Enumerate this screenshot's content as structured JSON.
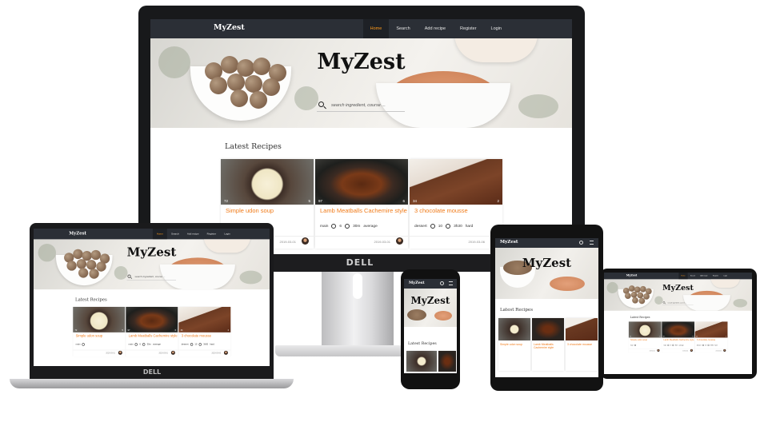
{
  "site": {
    "brand": "MyZest",
    "nav": [
      "Home",
      "Search",
      "Add recipe",
      "Register",
      "Login"
    ],
    "hero_title": "MyZest",
    "search_placeholder": "search ingredient, course ...",
    "section_title": "Latest Recipes",
    "device_brand": "DELL"
  },
  "recipes": [
    {
      "title": "Simple udon soup",
      "views": "72",
      "likes": "5",
      "course": "main",
      "servings": "",
      "time": "",
      "difficulty": "",
      "date": "2019-03-01"
    },
    {
      "title": "Lamb Meatballs Cachemire style",
      "views": "97",
      "likes": "6",
      "course": "main",
      "servings": "6",
      "time": "30m",
      "difficulty": "average",
      "date": "2019-03-01"
    },
    {
      "title": "3 chocolate mousse",
      "views": "34",
      "likes": "2",
      "course": "dessert",
      "servings": "10",
      "time": "3h30",
      "difficulty": "hard",
      "date": "2019-03-06"
    }
  ],
  "colors": {
    "accent": "#f07b1a",
    "nav_bg": "#2b2f36",
    "active": "#ff9a1a"
  }
}
